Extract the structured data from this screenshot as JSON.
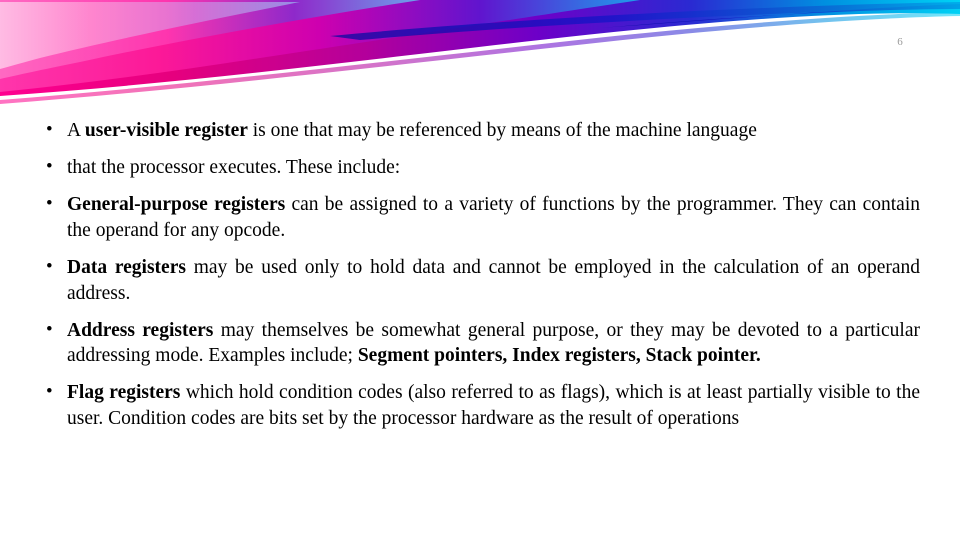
{
  "slide": {
    "number": "6",
    "accent_colors": {
      "magenta": "#e6007e",
      "pink": "#ff2aa0",
      "purple": "#8f00c8",
      "blue": "#0033cc",
      "cyan": "#00c8f0",
      "light_blue": "#4ab4f0"
    },
    "bullets": [
      {
        "id": "bullet-user-visible-register",
        "segments": [
          {
            "text": "A ",
            "bold": false
          },
          {
            "text": "user-visible register",
            "bold": true
          },
          {
            "text": " is one that may be referenced by means of the machine language",
            "bold": false
          }
        ]
      },
      {
        "id": "bullet-processor-executes",
        "segments": [
          {
            "text": "that the processor executes. These include:",
            "bold": false
          }
        ]
      },
      {
        "id": "bullet-general-purpose-registers",
        "segments": [
          {
            "text": "General-purpose registers",
            "bold": true
          },
          {
            "text": " can be assigned to a variety of functions by the programmer. They can contain the operand for any opcode.",
            "bold": false
          }
        ]
      },
      {
        "id": "bullet-data-registers",
        "segments": [
          {
            "text": "Data registers",
            "bold": true
          },
          {
            "text": " may be used only to hold data and cannot be employed in the calculation of an operand address.",
            "bold": false
          }
        ]
      },
      {
        "id": "bullet-address-registers",
        "segments": [
          {
            "text": "Address registers",
            "bold": true
          },
          {
            "text": " may themselves be somewhat general purpose, or they may be devoted to a particular addressing mode. Examples include; ",
            "bold": false
          },
          {
            "text": "Segment pointers, Index registers, Stack pointer.",
            "bold": true
          }
        ]
      },
      {
        "id": "bullet-flag-registers",
        "segments": [
          {
            "text": "Flag registers",
            "bold": true
          },
          {
            "text": " which hold condition codes (also referred to as flags), which is at least partially visible to the user. Condition codes are bits set by the processor hardware as the result of operations",
            "bold": false
          }
        ]
      }
    ]
  }
}
